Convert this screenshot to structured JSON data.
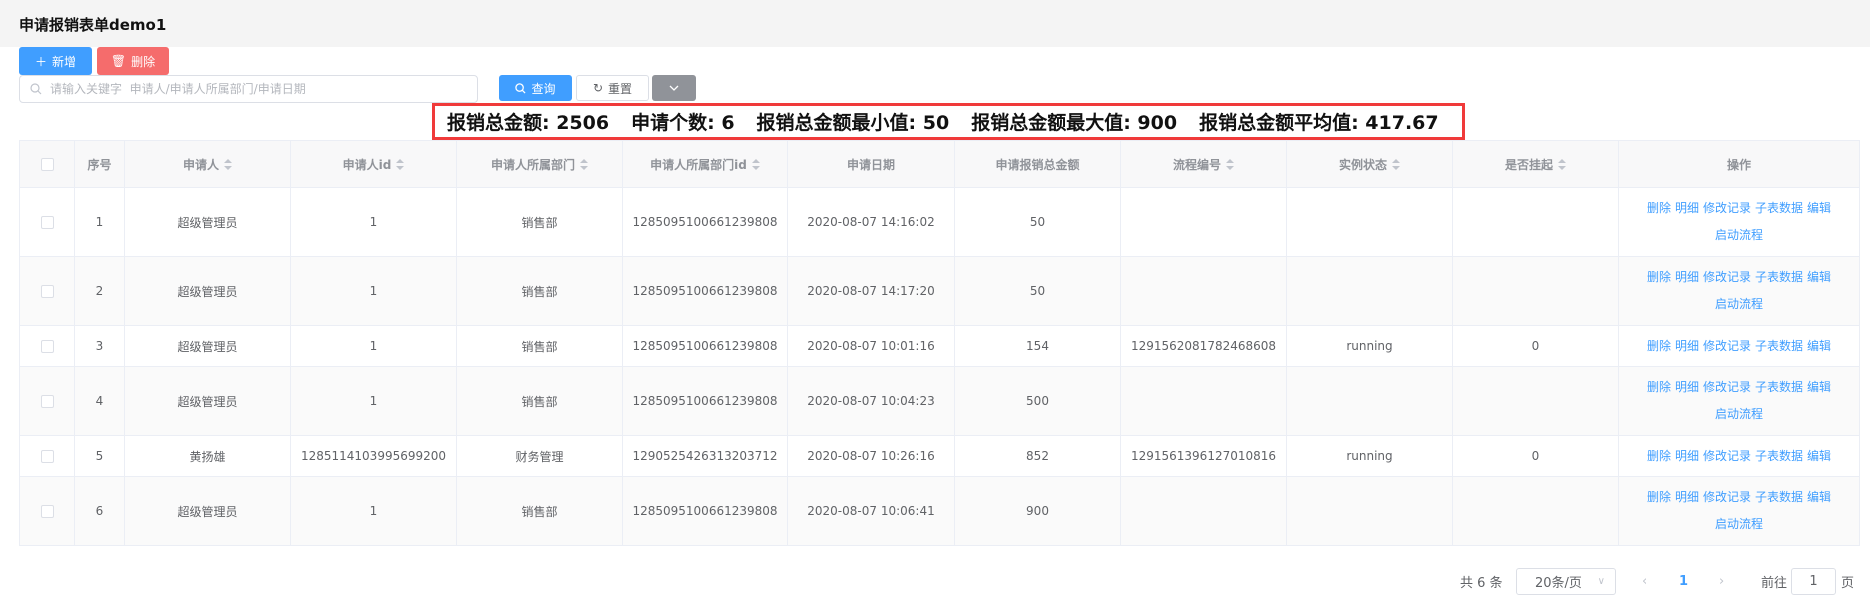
{
  "title": "申请报销表单demo1",
  "toolbar": {
    "add_label": "新增",
    "delete_label": "删除",
    "search_placeholder": "请输入关键字  申请人/申请人所属部门/申请日期",
    "query_label": "查询",
    "reset_label": "重置"
  },
  "summary": [
    "报销总金额: 2506",
    "申请个数: 6",
    "报销总金额最小值: 50",
    "报销总金额最大值: 900",
    "报销总金额平均值: 417.67"
  ],
  "columns": [
    "序号",
    "申请人",
    "申请人id",
    "申请人所属部门",
    "申请人所属部门id",
    "申请日期",
    "申请报销总金额",
    "流程编号",
    "实例状态",
    "是否挂起",
    "操作"
  ],
  "sortable": [
    false,
    true,
    true,
    true,
    true,
    false,
    false,
    true,
    true,
    true,
    false
  ],
  "rows": [
    {
      "no": "1",
      "applicant": "超级管理员",
      "applicant_id": "1",
      "dept": "销售部",
      "dept_id": "1285095100661239808",
      "date": "2020-08-07 14:16:02",
      "amount": "50",
      "process_no": "",
      "status": "",
      "suspended": "",
      "start": true
    },
    {
      "no": "2",
      "applicant": "超级管理员",
      "applicant_id": "1",
      "dept": "销售部",
      "dept_id": "1285095100661239808",
      "date": "2020-08-07 14:17:20",
      "amount": "50",
      "process_no": "",
      "status": "",
      "suspended": "",
      "start": true
    },
    {
      "no": "3",
      "applicant": "超级管理员",
      "applicant_id": "1",
      "dept": "销售部",
      "dept_id": "1285095100661239808",
      "date": "2020-08-07 10:01:16",
      "amount": "154",
      "process_no": "1291562081782468608",
      "status": "running",
      "suspended": "0",
      "start": false
    },
    {
      "no": "4",
      "applicant": "超级管理员",
      "applicant_id": "1",
      "dept": "销售部",
      "dept_id": "1285095100661239808",
      "date": "2020-08-07 10:04:23",
      "amount": "500",
      "process_no": "",
      "status": "",
      "suspended": "",
      "start": true
    },
    {
      "no": "5",
      "applicant": "黄扬雄",
      "applicant_id": "1285114103995699200",
      "dept": "财务管理",
      "dept_id": "1290525426313203712",
      "date": "2020-08-07 10:26:16",
      "amount": "852",
      "process_no": "1291561396127010816",
      "status": "running",
      "suspended": "0",
      "start": false
    },
    {
      "no": "6",
      "applicant": "超级管理员",
      "applicant_id": "1",
      "dept": "销售部",
      "dept_id": "1285095100661239808",
      "date": "2020-08-07 10:06:41",
      "amount": "900",
      "process_no": "",
      "status": "",
      "suspended": "",
      "start": true
    }
  ],
  "row_actions": [
    "删除",
    "明细",
    "修改记录",
    "子表数据",
    "编辑"
  ],
  "start_action": "启动流程",
  "pagination": {
    "total": "共 6 条",
    "page_size": "20条/页",
    "current": "1",
    "goto_prefix": "前往",
    "goto_value": "1",
    "goto_suffix": "页"
  },
  "colors": {
    "primary": "#409eff",
    "danger": "#f56c6c",
    "highlight_border": "#f03a3a"
  }
}
